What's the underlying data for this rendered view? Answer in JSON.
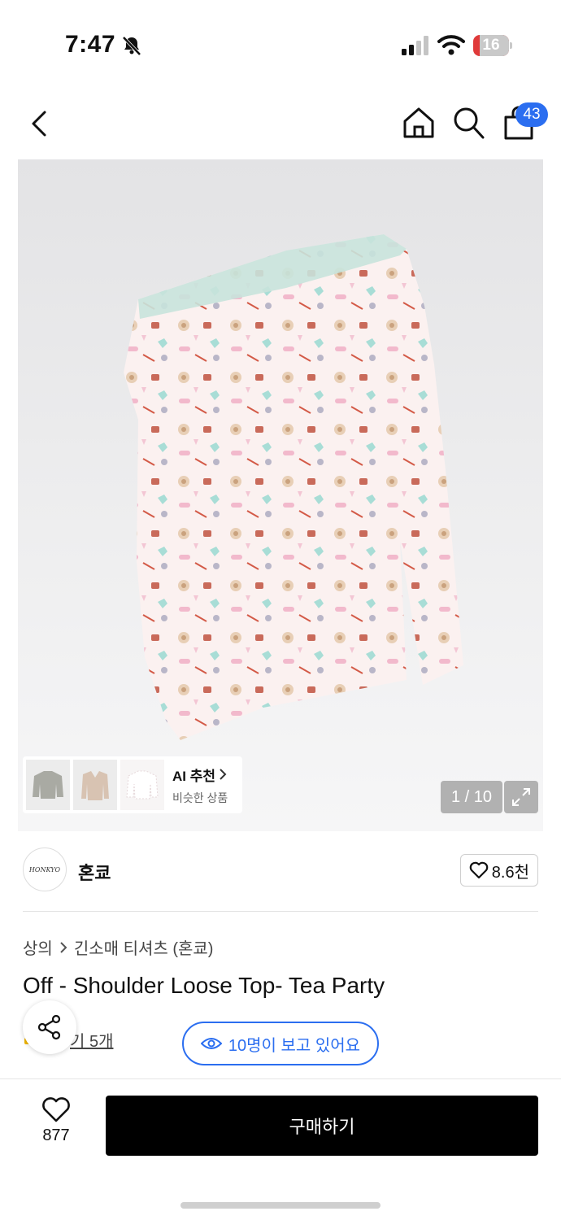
{
  "status_bar": {
    "time": "7:47",
    "battery": "16"
  },
  "nav": {
    "cart_count": "43",
    "icons": [
      "back-icon",
      "home-icon",
      "search-icon",
      "shopping-bag-icon"
    ]
  },
  "gallery": {
    "counter": "1 / 10",
    "ai_rec_title": "AI 추천",
    "ai_rec_subtitle": "비슷한 상품"
  },
  "brand": {
    "logo_text": "HONKYO",
    "name": "혼쿄",
    "likes": "8.6천"
  },
  "breadcrumb": {
    "category": "상의",
    "subcategory": "긴소매 티셔츠 (혼쿄)"
  },
  "product": {
    "title": "Off - Shoulder Loose Top- Tea Party",
    "reviews_text": "기 5개",
    "viewers_text": "10명이 보고 있어요"
  },
  "bottom": {
    "like_count": "877",
    "buy_label": "구매하기"
  },
  "colors": {
    "accent": "#2b6ef0",
    "buy_button": "#000000",
    "battery_low": "#e03a3a"
  }
}
